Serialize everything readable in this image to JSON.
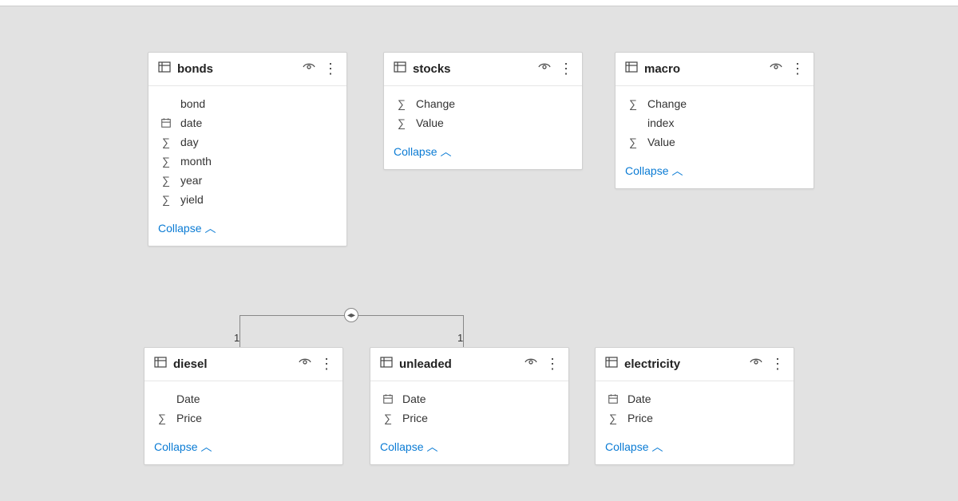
{
  "collapse_label": "Collapse",
  "relationship": {
    "left_cardinality": "1",
    "right_cardinality": "1",
    "direction_symbol": "⧬"
  },
  "tables": {
    "bonds": {
      "name": "bonds",
      "fields": [
        {
          "icon": "none",
          "label": "bond"
        },
        {
          "icon": "date",
          "label": "date"
        },
        {
          "icon": "sigma",
          "label": "day"
        },
        {
          "icon": "sigma",
          "label": "month"
        },
        {
          "icon": "sigma",
          "label": "year"
        },
        {
          "icon": "sigma",
          "label": "yield"
        }
      ]
    },
    "stocks": {
      "name": "stocks",
      "fields": [
        {
          "icon": "sigma",
          "label": "Change"
        },
        {
          "icon": "sigma",
          "label": "Value"
        }
      ]
    },
    "macro": {
      "name": "macro",
      "fields": [
        {
          "icon": "sigma",
          "label": "Change"
        },
        {
          "icon": "none",
          "label": "index"
        },
        {
          "icon": "sigma",
          "label": "Value"
        }
      ]
    },
    "diesel": {
      "name": "diesel",
      "fields": [
        {
          "icon": "none",
          "label": "Date"
        },
        {
          "icon": "sigma",
          "label": "Price"
        }
      ]
    },
    "unleaded": {
      "name": "unleaded",
      "fields": [
        {
          "icon": "date",
          "label": "Date"
        },
        {
          "icon": "sigma",
          "label": "Price"
        }
      ]
    },
    "electricity": {
      "name": "electricity",
      "fields": [
        {
          "icon": "date",
          "label": "Date"
        },
        {
          "icon": "sigma",
          "label": "Price"
        }
      ]
    }
  }
}
